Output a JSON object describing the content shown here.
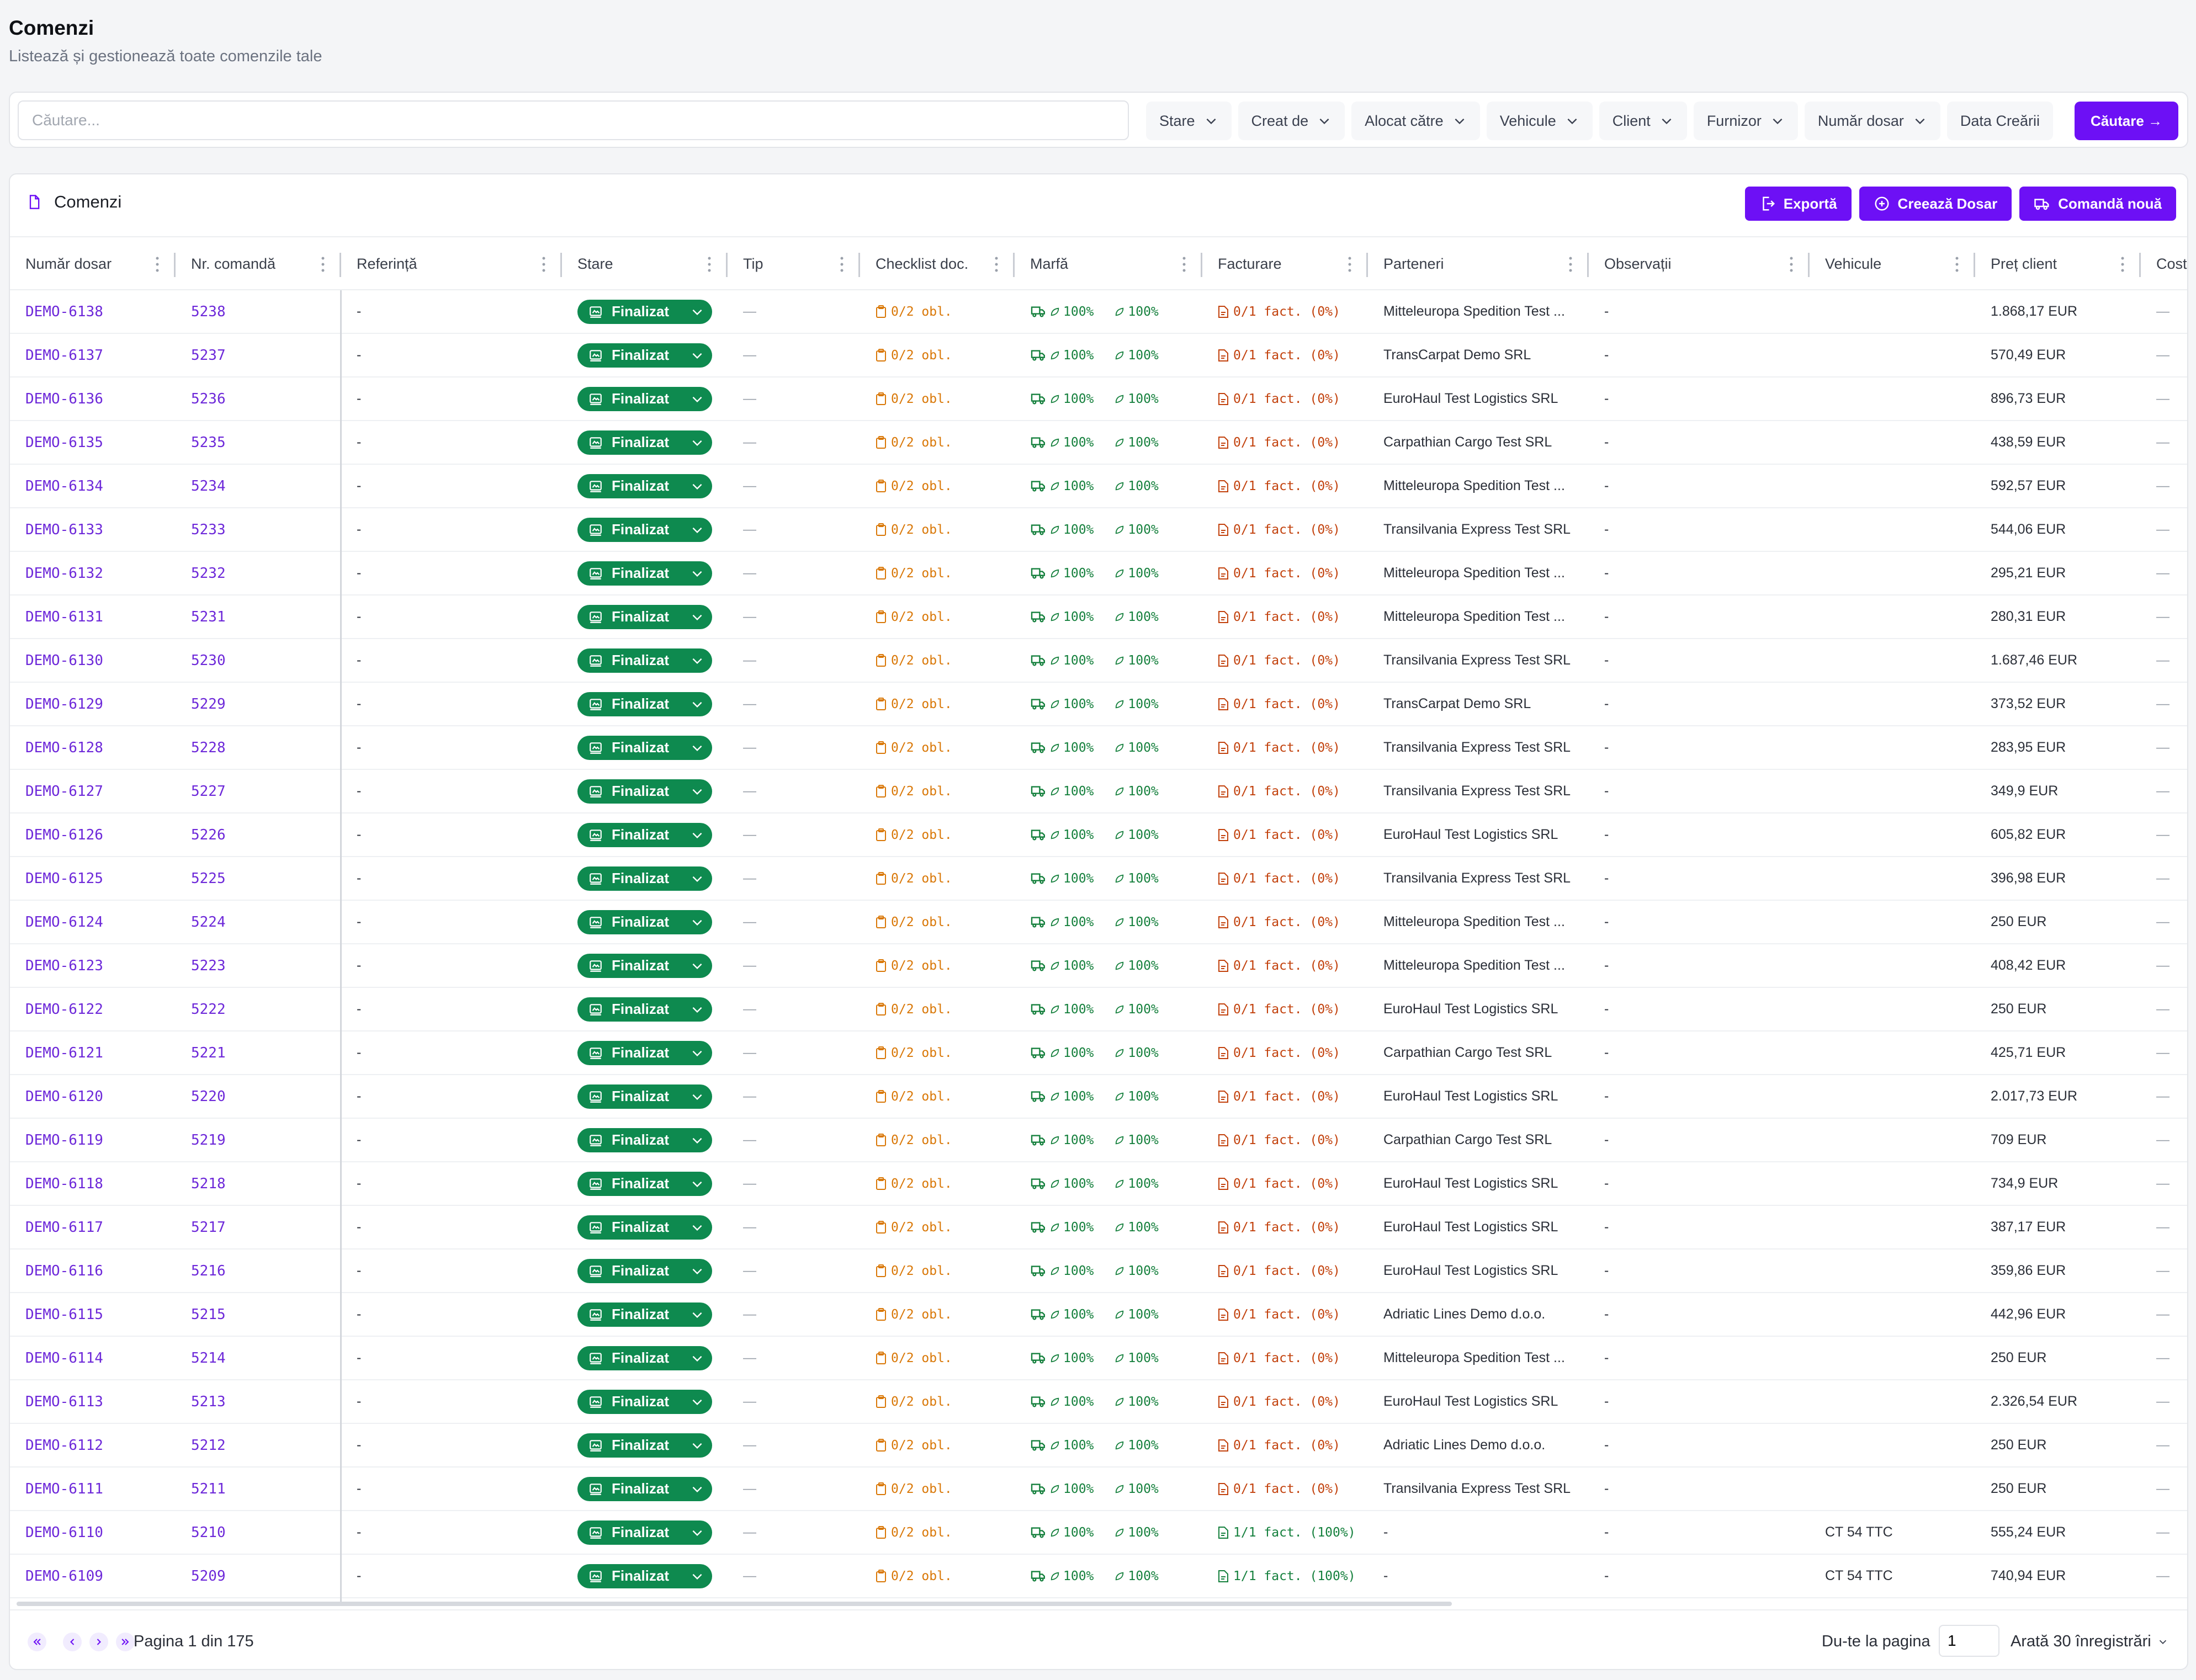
{
  "page": {
    "title": "Comenzi",
    "subtitle": "Listează și gestionează toate comenzile tale"
  },
  "search": {
    "placeholder": "Căutare...",
    "button_label": "Căutare →"
  },
  "filters": [
    {
      "label": "Stare",
      "dropdown": true
    },
    {
      "label": "Creat de",
      "dropdown": true
    },
    {
      "label": "Alocat către",
      "dropdown": true
    },
    {
      "label": "Vehicule",
      "dropdown": true
    },
    {
      "label": "Client",
      "dropdown": true
    },
    {
      "label": "Furnizor",
      "dropdown": true
    },
    {
      "label": "Număr dosar",
      "dropdown": true
    },
    {
      "label": "Data Creării",
      "dropdown": false
    }
  ],
  "card": {
    "title": "Comenzi",
    "actions": [
      {
        "label": "Exportă",
        "icon": "export-icon"
      },
      {
        "label": "Creează Dosar",
        "icon": "plus-circle-icon"
      },
      {
        "label": "Comandă nouă",
        "icon": "truck-icon"
      }
    ]
  },
  "table": {
    "columns": [
      "Număr dosar",
      "Nr. comandă",
      "Referință",
      "Stare",
      "Tip",
      "Checklist doc.",
      "Marfă",
      "Facturare",
      "Parteneri",
      "Observații",
      "Vehicule",
      "Preț client",
      "Cost"
    ],
    "status_label": "Finalizat",
    "checklist_label": "0/2 obl.",
    "marfa_a": "100%",
    "marfa_b": "100%",
    "empty": "-",
    "em_dash": "—",
    "rows": [
      {
        "dosar": "DEMO-6138",
        "comanda": "5238",
        "partener": "Mitteleuropa Spedition Test ...",
        "factura": "0/1 fact. (0%)",
        "factura_ok": false,
        "vehicul": "",
        "pret": "1.868,17 EUR"
      },
      {
        "dosar": "DEMO-6137",
        "comanda": "5237",
        "partener": "TransCarpat Demo SRL",
        "factura": "0/1 fact. (0%)",
        "factura_ok": false,
        "vehicul": "",
        "pret": "570,49 EUR"
      },
      {
        "dosar": "DEMO-6136",
        "comanda": "5236",
        "partener": "EuroHaul Test Logistics SRL",
        "factura": "0/1 fact. (0%)",
        "factura_ok": false,
        "vehicul": "",
        "pret": "896,73 EUR"
      },
      {
        "dosar": "DEMO-6135",
        "comanda": "5235",
        "partener": "Carpathian Cargo Test SRL",
        "factura": "0/1 fact. (0%)",
        "factura_ok": false,
        "vehicul": "",
        "pret": "438,59 EUR"
      },
      {
        "dosar": "DEMO-6134",
        "comanda": "5234",
        "partener": "Mitteleuropa Spedition Test ...",
        "factura": "0/1 fact. (0%)",
        "factura_ok": false,
        "vehicul": "",
        "pret": "592,57 EUR"
      },
      {
        "dosar": "DEMO-6133",
        "comanda": "5233",
        "partener": "Transilvania Express Test SRL",
        "factura": "0/1 fact. (0%)",
        "factura_ok": false,
        "vehicul": "",
        "pret": "544,06 EUR"
      },
      {
        "dosar": "DEMO-6132",
        "comanda": "5232",
        "partener": "Mitteleuropa Spedition Test ...",
        "factura": "0/1 fact. (0%)",
        "factura_ok": false,
        "vehicul": "",
        "pret": "295,21 EUR"
      },
      {
        "dosar": "DEMO-6131",
        "comanda": "5231",
        "partener": "Mitteleuropa Spedition Test ...",
        "factura": "0/1 fact. (0%)",
        "factura_ok": false,
        "vehicul": "",
        "pret": "280,31 EUR"
      },
      {
        "dosar": "DEMO-6130",
        "comanda": "5230",
        "partener": "Transilvania Express Test SRL",
        "factura": "0/1 fact. (0%)",
        "factura_ok": false,
        "vehicul": "",
        "pret": "1.687,46 EUR"
      },
      {
        "dosar": "DEMO-6129",
        "comanda": "5229",
        "partener": "TransCarpat Demo SRL",
        "factura": "0/1 fact. (0%)",
        "factura_ok": false,
        "vehicul": "",
        "pret": "373,52 EUR"
      },
      {
        "dosar": "DEMO-6128",
        "comanda": "5228",
        "partener": "Transilvania Express Test SRL",
        "factura": "0/1 fact. (0%)",
        "factura_ok": false,
        "vehicul": "",
        "pret": "283,95 EUR"
      },
      {
        "dosar": "DEMO-6127",
        "comanda": "5227",
        "partener": "Transilvania Express Test SRL",
        "factura": "0/1 fact. (0%)",
        "factura_ok": false,
        "vehicul": "",
        "pret": "349,9 EUR"
      },
      {
        "dosar": "DEMO-6126",
        "comanda": "5226",
        "partener": "EuroHaul Test Logistics SRL",
        "factura": "0/1 fact. (0%)",
        "factura_ok": false,
        "vehicul": "",
        "pret": "605,82 EUR"
      },
      {
        "dosar": "DEMO-6125",
        "comanda": "5225",
        "partener": "Transilvania Express Test SRL",
        "factura": "0/1 fact. (0%)",
        "factura_ok": false,
        "vehicul": "",
        "pret": "396,98 EUR"
      },
      {
        "dosar": "DEMO-6124",
        "comanda": "5224",
        "partener": "Mitteleuropa Spedition Test ...",
        "factura": "0/1 fact. (0%)",
        "factura_ok": false,
        "vehicul": "",
        "pret": "250 EUR"
      },
      {
        "dosar": "DEMO-6123",
        "comanda": "5223",
        "partener": "Mitteleuropa Spedition Test ...",
        "factura": "0/1 fact. (0%)",
        "factura_ok": false,
        "vehicul": "",
        "pret": "408,42 EUR"
      },
      {
        "dosar": "DEMO-6122",
        "comanda": "5222",
        "partener": "EuroHaul Test Logistics SRL",
        "factura": "0/1 fact. (0%)",
        "factura_ok": false,
        "vehicul": "",
        "pret": "250 EUR"
      },
      {
        "dosar": "DEMO-6121",
        "comanda": "5221",
        "partener": "Carpathian Cargo Test SRL",
        "factura": "0/1 fact. (0%)",
        "factura_ok": false,
        "vehicul": "",
        "pret": "425,71 EUR"
      },
      {
        "dosar": "DEMO-6120",
        "comanda": "5220",
        "partener": "EuroHaul Test Logistics SRL",
        "factura": "0/1 fact. (0%)",
        "factura_ok": false,
        "vehicul": "",
        "pret": "2.017,73 EUR"
      },
      {
        "dosar": "DEMO-6119",
        "comanda": "5219",
        "partener": "Carpathian Cargo Test SRL",
        "factura": "0/1 fact. (0%)",
        "factura_ok": false,
        "vehicul": "",
        "pret": "709 EUR"
      },
      {
        "dosar": "DEMO-6118",
        "comanda": "5218",
        "partener": "EuroHaul Test Logistics SRL",
        "factura": "0/1 fact. (0%)",
        "factura_ok": false,
        "vehicul": "",
        "pret": "734,9 EUR"
      },
      {
        "dosar": "DEMO-6117",
        "comanda": "5217",
        "partener": "EuroHaul Test Logistics SRL",
        "factura": "0/1 fact. (0%)",
        "factura_ok": false,
        "vehicul": "",
        "pret": "387,17 EUR"
      },
      {
        "dosar": "DEMO-6116",
        "comanda": "5216",
        "partener": "EuroHaul Test Logistics SRL",
        "factura": "0/1 fact. (0%)",
        "factura_ok": false,
        "vehicul": "",
        "pret": "359,86 EUR"
      },
      {
        "dosar": "DEMO-6115",
        "comanda": "5215",
        "partener": "Adriatic Lines Demo d.o.o.",
        "factura": "0/1 fact. (0%)",
        "factura_ok": false,
        "vehicul": "",
        "pret": "442,96 EUR"
      },
      {
        "dosar": "DEMO-6114",
        "comanda": "5214",
        "partener": "Mitteleuropa Spedition Test ...",
        "factura": "0/1 fact. (0%)",
        "factura_ok": false,
        "vehicul": "",
        "pret": "250 EUR"
      },
      {
        "dosar": "DEMO-6113",
        "comanda": "5213",
        "partener": "EuroHaul Test Logistics SRL",
        "factura": "0/1 fact. (0%)",
        "factura_ok": false,
        "vehicul": "",
        "pret": "2.326,54 EUR"
      },
      {
        "dosar": "DEMO-6112",
        "comanda": "5212",
        "partener": "Adriatic Lines Demo d.o.o.",
        "factura": "0/1 fact. (0%)",
        "factura_ok": false,
        "vehicul": "",
        "pret": "250 EUR"
      },
      {
        "dosar": "DEMO-6111",
        "comanda": "5211",
        "partener": "Transilvania Express Test SRL",
        "factura": "0/1 fact. (0%)",
        "factura_ok": false,
        "vehicul": "",
        "pret": "250 EUR"
      },
      {
        "dosar": "DEMO-6110",
        "comanda": "5210",
        "partener": "-",
        "factura": "1/1 fact. (100%)",
        "factura_ok": true,
        "vehicul": "CT 54 TTC",
        "pret": "555,24 EUR"
      },
      {
        "dosar": "DEMO-6109",
        "comanda": "5209",
        "partener": "-",
        "factura": "1/1 fact. (100%)",
        "factura_ok": true,
        "vehicul": "CT 54 TTC",
        "pret": "740,94 EUR"
      }
    ]
  },
  "pagination": {
    "page_text": "Pagina 1 din 175",
    "goto_label": "Du-te la pagina",
    "goto_value": "1",
    "page_size_label": "Arată 30 înregistrări"
  },
  "colors": {
    "accent": "#6d10f5",
    "status_green": "#0e8a4f",
    "link_purple": "#6d28d9",
    "warning_orange": "#c2410c"
  }
}
